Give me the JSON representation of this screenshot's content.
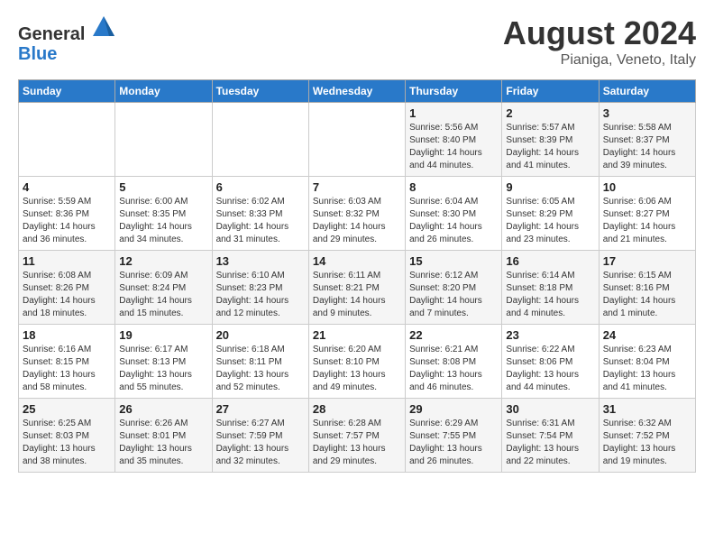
{
  "header": {
    "logo_general": "General",
    "logo_blue": "Blue",
    "month_year": "August 2024",
    "location": "Pianiga, Veneto, Italy"
  },
  "days_of_week": [
    "Sunday",
    "Monday",
    "Tuesday",
    "Wednesday",
    "Thursday",
    "Friday",
    "Saturday"
  ],
  "weeks": [
    [
      {
        "day": "",
        "info": ""
      },
      {
        "day": "",
        "info": ""
      },
      {
        "day": "",
        "info": ""
      },
      {
        "day": "",
        "info": ""
      },
      {
        "day": "1",
        "info": "Sunrise: 5:56 AM\nSunset: 8:40 PM\nDaylight: 14 hours\nand 44 minutes."
      },
      {
        "day": "2",
        "info": "Sunrise: 5:57 AM\nSunset: 8:39 PM\nDaylight: 14 hours\nand 41 minutes."
      },
      {
        "day": "3",
        "info": "Sunrise: 5:58 AM\nSunset: 8:37 PM\nDaylight: 14 hours\nand 39 minutes."
      }
    ],
    [
      {
        "day": "4",
        "info": "Sunrise: 5:59 AM\nSunset: 8:36 PM\nDaylight: 14 hours\nand 36 minutes."
      },
      {
        "day": "5",
        "info": "Sunrise: 6:00 AM\nSunset: 8:35 PM\nDaylight: 14 hours\nand 34 minutes."
      },
      {
        "day": "6",
        "info": "Sunrise: 6:02 AM\nSunset: 8:33 PM\nDaylight: 14 hours\nand 31 minutes."
      },
      {
        "day": "7",
        "info": "Sunrise: 6:03 AM\nSunset: 8:32 PM\nDaylight: 14 hours\nand 29 minutes."
      },
      {
        "day": "8",
        "info": "Sunrise: 6:04 AM\nSunset: 8:30 PM\nDaylight: 14 hours\nand 26 minutes."
      },
      {
        "day": "9",
        "info": "Sunrise: 6:05 AM\nSunset: 8:29 PM\nDaylight: 14 hours\nand 23 minutes."
      },
      {
        "day": "10",
        "info": "Sunrise: 6:06 AM\nSunset: 8:27 PM\nDaylight: 14 hours\nand 21 minutes."
      }
    ],
    [
      {
        "day": "11",
        "info": "Sunrise: 6:08 AM\nSunset: 8:26 PM\nDaylight: 14 hours\nand 18 minutes."
      },
      {
        "day": "12",
        "info": "Sunrise: 6:09 AM\nSunset: 8:24 PM\nDaylight: 14 hours\nand 15 minutes."
      },
      {
        "day": "13",
        "info": "Sunrise: 6:10 AM\nSunset: 8:23 PM\nDaylight: 14 hours\nand 12 minutes."
      },
      {
        "day": "14",
        "info": "Sunrise: 6:11 AM\nSunset: 8:21 PM\nDaylight: 14 hours\nand 9 minutes."
      },
      {
        "day": "15",
        "info": "Sunrise: 6:12 AM\nSunset: 8:20 PM\nDaylight: 14 hours\nand 7 minutes."
      },
      {
        "day": "16",
        "info": "Sunrise: 6:14 AM\nSunset: 8:18 PM\nDaylight: 14 hours\nand 4 minutes."
      },
      {
        "day": "17",
        "info": "Sunrise: 6:15 AM\nSunset: 8:16 PM\nDaylight: 14 hours\nand 1 minute."
      }
    ],
    [
      {
        "day": "18",
        "info": "Sunrise: 6:16 AM\nSunset: 8:15 PM\nDaylight: 13 hours\nand 58 minutes."
      },
      {
        "day": "19",
        "info": "Sunrise: 6:17 AM\nSunset: 8:13 PM\nDaylight: 13 hours\nand 55 minutes."
      },
      {
        "day": "20",
        "info": "Sunrise: 6:18 AM\nSunset: 8:11 PM\nDaylight: 13 hours\nand 52 minutes."
      },
      {
        "day": "21",
        "info": "Sunrise: 6:20 AM\nSunset: 8:10 PM\nDaylight: 13 hours\nand 49 minutes."
      },
      {
        "day": "22",
        "info": "Sunrise: 6:21 AM\nSunset: 8:08 PM\nDaylight: 13 hours\nand 46 minutes."
      },
      {
        "day": "23",
        "info": "Sunrise: 6:22 AM\nSunset: 8:06 PM\nDaylight: 13 hours\nand 44 minutes."
      },
      {
        "day": "24",
        "info": "Sunrise: 6:23 AM\nSunset: 8:04 PM\nDaylight: 13 hours\nand 41 minutes."
      }
    ],
    [
      {
        "day": "25",
        "info": "Sunrise: 6:25 AM\nSunset: 8:03 PM\nDaylight: 13 hours\nand 38 minutes."
      },
      {
        "day": "26",
        "info": "Sunrise: 6:26 AM\nSunset: 8:01 PM\nDaylight: 13 hours\nand 35 minutes."
      },
      {
        "day": "27",
        "info": "Sunrise: 6:27 AM\nSunset: 7:59 PM\nDaylight: 13 hours\nand 32 minutes."
      },
      {
        "day": "28",
        "info": "Sunrise: 6:28 AM\nSunset: 7:57 PM\nDaylight: 13 hours\nand 29 minutes."
      },
      {
        "day": "29",
        "info": "Sunrise: 6:29 AM\nSunset: 7:55 PM\nDaylight: 13 hours\nand 26 minutes."
      },
      {
        "day": "30",
        "info": "Sunrise: 6:31 AM\nSunset: 7:54 PM\nDaylight: 13 hours\nand 22 minutes."
      },
      {
        "day": "31",
        "info": "Sunrise: 6:32 AM\nSunset: 7:52 PM\nDaylight: 13 hours\nand 19 minutes."
      }
    ]
  ]
}
